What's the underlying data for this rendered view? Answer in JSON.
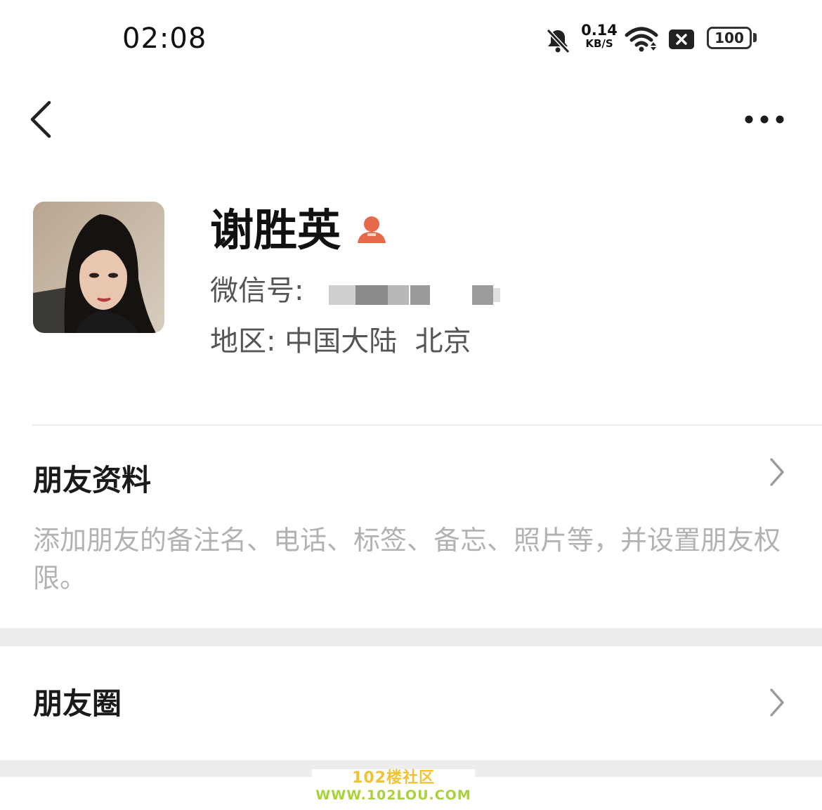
{
  "status_bar": {
    "time": "02:08",
    "net_speed_value": "0.14",
    "net_speed_unit": "KB/S",
    "battery_level": "100",
    "icons": [
      "bell-muted-icon",
      "wifi-icon",
      "sim-x-icon",
      "battery-icon"
    ]
  },
  "nav": {
    "back_icon": "chevron-left-icon",
    "more_icon": "more-dots-icon"
  },
  "profile": {
    "name": "谢胜英",
    "name_icon": "contact-person-icon",
    "wechat_id_label": "微信号:",
    "region_label": "地区:",
    "region_value": "中国大陆  北京"
  },
  "rows": {
    "friend_info": {
      "title": "朋友资料",
      "description": "添加朋友的备注名、电话、标签、备忘、照片等，并设置朋友权限。"
    },
    "moments": {
      "title": "朋友圈"
    }
  },
  "watermark": {
    "title": "102楼社区",
    "url": "WWW.102LOU.COM"
  },
  "colors": {
    "accent_icon": "#e8694a",
    "secondary_text": "#b2b2b2",
    "divider_band": "#ededed"
  }
}
